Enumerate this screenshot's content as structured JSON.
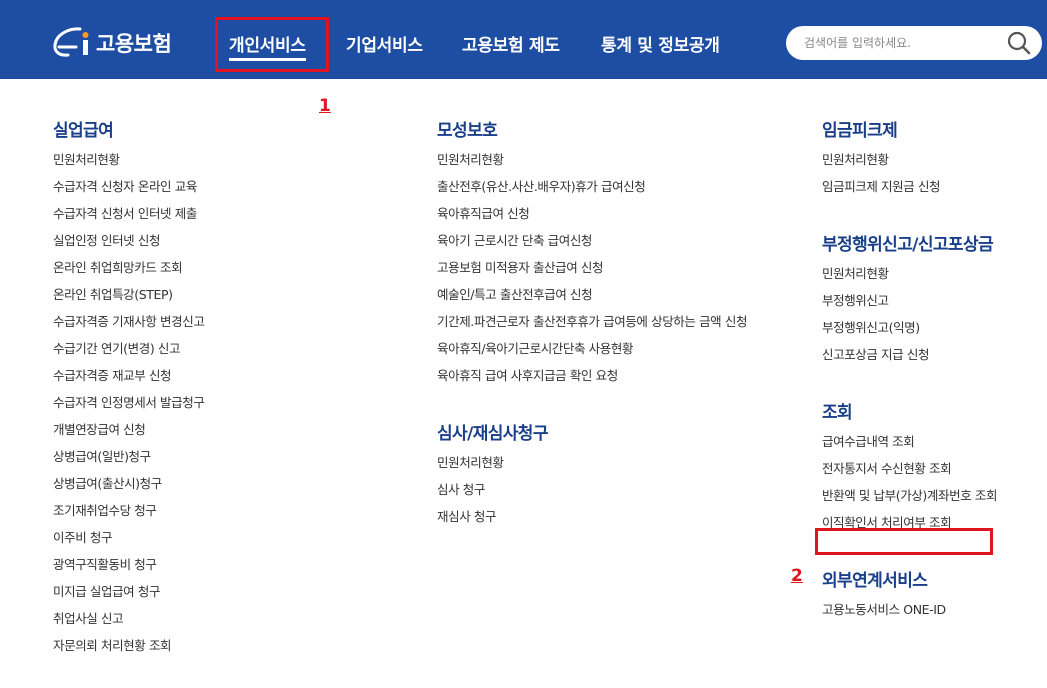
{
  "header": {
    "logo_text": "고용보험",
    "nav": [
      {
        "label": "개인서비스"
      },
      {
        "label": "기업서비스"
      },
      {
        "label": "고용보험 제도"
      },
      {
        "label": "통계 및 정보공개"
      }
    ],
    "search_placeholder": "검색어를 입력하세요."
  },
  "annotations": {
    "n1": "1",
    "n2": "2"
  },
  "menu": {
    "col1": {
      "title": "실업급여",
      "items": [
        "민원처리현황",
        "수급자격 신청자 온라인 교육",
        "수급자격 신청서 인터넷 제출",
        "실업인정 인터넷 신청",
        "온라인 취업희망카드 조회",
        "온라인 취업특강(STEP)",
        "수급자격증 기재사항 변경신고",
        "수급기간 연기(변경) 신고",
        "수급자격증 재교부 신청",
        "수급자격 인정명세서 발급청구",
        "개별연장급여 신청",
        "상병급여(일반)청구",
        "상병급여(출산시)청구",
        "조기재취업수당 청구",
        "이주비 청구",
        "광역구직활동비 청구",
        "미지급 실업급여 청구",
        "취업사실 신고",
        "자문의뢰 처리현황 조회"
      ]
    },
    "col2a": {
      "title": "모성보호",
      "items": [
        "민원처리현황",
        "출산전후(유산.사산.배우자)휴가 급여신청",
        "육아휴직급여 신청",
        "육아기 근로시간 단축 급여신청",
        "고용보험 미적용자 출산급여 신청",
        "예술인/특고 출산전후급여 신청",
        "기간제.파견근로자 출산전후휴가 급여등에 상당하는 금액 신청",
        "육아휴직/육아기근로시간단축 사용현황",
        "육아휴직 급여 사후지급금 확인 요청"
      ]
    },
    "col2b": {
      "title": "심사/재심사청구",
      "items": [
        "민원처리현황",
        "심사 청구",
        "재심사 청구"
      ]
    },
    "col3a": {
      "title": "임금피크제",
      "items": [
        "민원처리현황",
        "임금피크제 지원금 신청"
      ]
    },
    "col3b": {
      "title": "부정행위신고/신고포상금",
      "items": [
        "민원처리현황",
        "부정행위신고",
        "부정행위신고(익명)",
        "신고포상금 지급 신청"
      ]
    },
    "col3c": {
      "title": "조회",
      "items": [
        "급여수급내역 조회",
        "전자통지서 수신현황 조회",
        "반환액 및 납부(가상)계좌번호 조회",
        "이직확인서 처리여부 조회"
      ]
    },
    "col3d": {
      "title": "외부연계서비스",
      "items": [
        "고용노동서비스 ONE-ID"
      ]
    }
  }
}
